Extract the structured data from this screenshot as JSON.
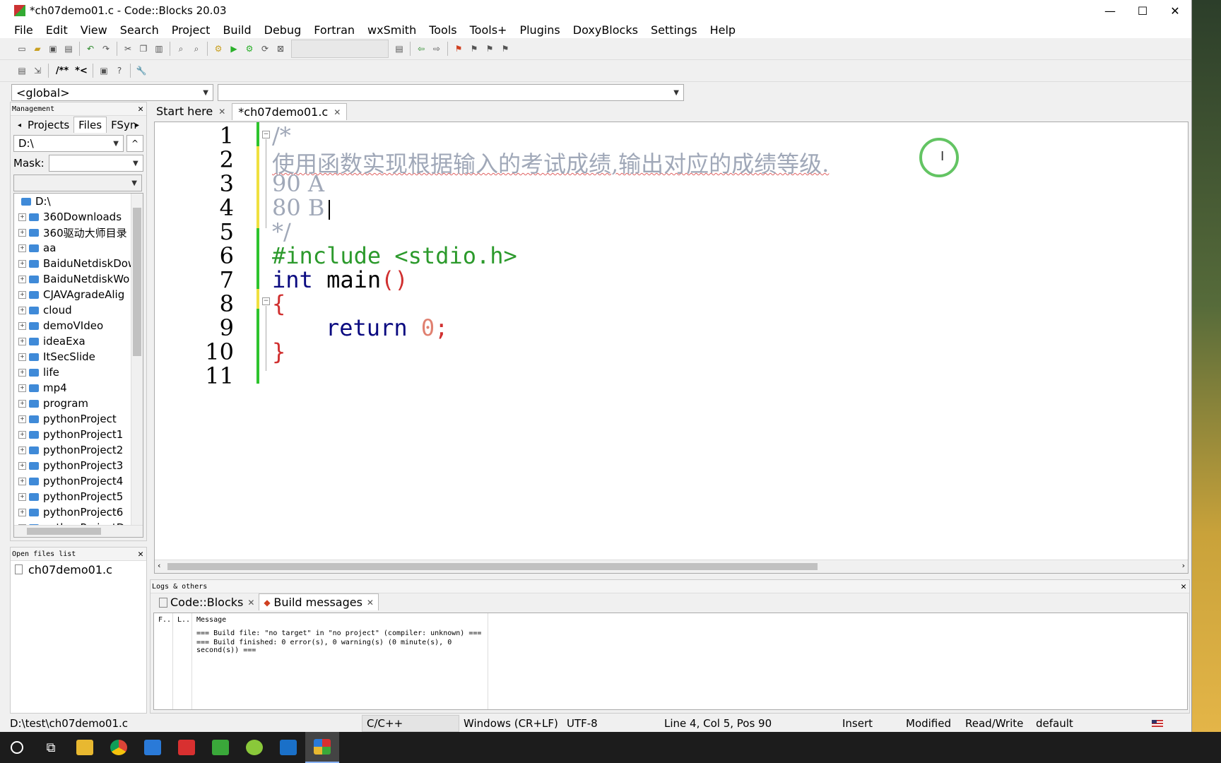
{
  "window": {
    "title": "*ch07demo01.c - Code::Blocks 20.03",
    "controls": [
      "—",
      "☐",
      "✕"
    ]
  },
  "menu": [
    "File",
    "Edit",
    "View",
    "Search",
    "Project",
    "Build",
    "Debug",
    "Fortran",
    "wxSmith",
    "Tools",
    "Tools+",
    "Plugins",
    "DoxyBlocks",
    "Settings",
    "Help"
  ],
  "toolbar2": {
    "doc_comment": "/**",
    "line_comment": "*<"
  },
  "scope": {
    "global": "<global>",
    "function": ""
  },
  "management": {
    "header": "Management",
    "tabs": [
      "Projects",
      "Files",
      "FSyn"
    ],
    "drive": "D:\\",
    "mask_label": "Mask:",
    "tree_root": "D:\\",
    "folders": [
      "360Downloads",
      "360驱动大师目录",
      "aa",
      "BaiduNetdiskDow",
      "BaiduNetdiskWo",
      "CJAVAgradeAlig",
      "cloud",
      "demoVIdeo",
      "ideaExa",
      "ItSecSlide",
      "life",
      "mp4",
      "program",
      "pythonProject",
      "pythonProject1",
      "pythonProject2",
      "pythonProject3",
      "pythonProject4",
      "pythonProject5",
      "pythonProject6",
      "pythonProjectD"
    ]
  },
  "open_files": {
    "header": "Open files list",
    "files": [
      "ch07demo01.c"
    ]
  },
  "editor": {
    "tabs": [
      "Start here",
      "*ch07demo01.c"
    ],
    "line_numbers": [
      "1",
      "2",
      "3",
      "4",
      "5",
      "6",
      "7",
      "8",
      "9",
      "10",
      "11"
    ],
    "lines": {
      "l1": "/*",
      "l2": "使用函数实现根据输入的考试成绩,输出对应的成绩等级.",
      "l3": "90 A",
      "l4": "80 B",
      "l5": "*/",
      "l6": "#include <stdio.h>",
      "l7_kw": "int",
      "l7_rest": " main",
      "l7_paren": "()",
      "l8": "{",
      "l9_kw": "return",
      "l9_num": "0",
      "l9_semi": ";",
      "l10": "}"
    }
  },
  "logs": {
    "header": "Logs & others",
    "tabs": [
      "Code::Blocks",
      "Build messages"
    ],
    "columns": [
      "F..",
      "L..",
      "Message"
    ],
    "messages": [
      "=== Build file: \"no target\" in \"no project\" (compiler: unknown) ===",
      "=== Build finished: 0 error(s), 0 warning(s) (0 minute(s), 0 second(s)) ==="
    ]
  },
  "status": {
    "path": "D:\\test\\ch07demo01.c",
    "language": "C/C++",
    "eol": "Windows (CR+LF)",
    "encoding": "UTF-8",
    "position": "Line 4, Col 5, Pos 90",
    "mode": "Insert",
    "modified": "Modified",
    "access": "Read/Write",
    "profile": "default"
  },
  "colors": {
    "change_saved": "#2ec42e",
    "change_unsaved": "#f0e040",
    "preprocessor": "#2c9a2c",
    "keyword": "#0a0a80",
    "comment": "#a0a8b8",
    "brace": "#d03030"
  }
}
